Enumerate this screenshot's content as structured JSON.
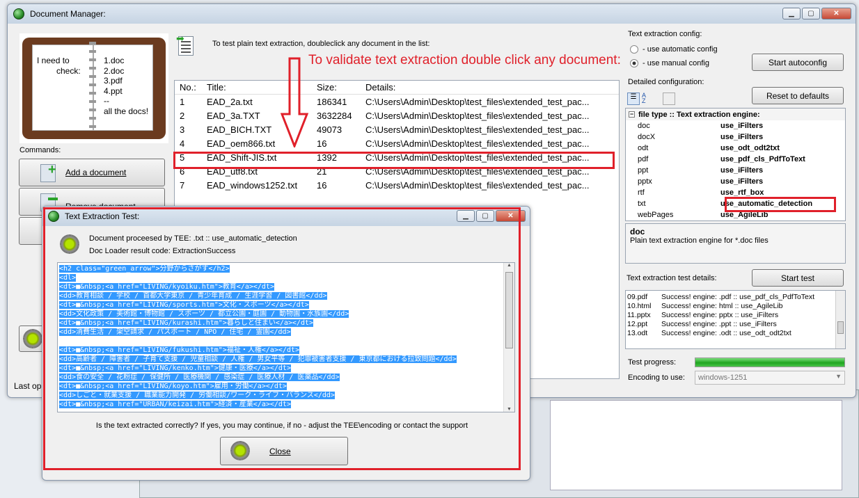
{
  "main_window": {
    "title": "Document Manager:",
    "hint": "To test plain text extraction, doubleclick any document in the list:",
    "commands_label": "Commands:",
    "add_document": "Add a document",
    "remove_document": "Remove document",
    "status_text": "Last op",
    "notebook": {
      "left": [
        "I need to",
        "check:"
      ],
      "right": [
        "1.doc",
        "2.doc",
        "3.pdf",
        "4.ppt",
        "--",
        "all the docs!"
      ]
    },
    "table": {
      "headers": [
        "No.:",
        "Title:",
        "Size:",
        "Details:"
      ],
      "rows": [
        {
          "no": "1",
          "title": "EAD_2a.txt",
          "size": "186341",
          "details": "C:\\Users\\Admin\\Desktop\\test_files\\extended_test_pac..."
        },
        {
          "no": "2",
          "title": "EAD_3a.TXT",
          "size": "3632284",
          "details": "C:\\Users\\Admin\\Desktop\\test_files\\extended_test_pac..."
        },
        {
          "no": "3",
          "title": "EAD_BICH.TXT",
          "size": "49073",
          "details": "C:\\Users\\Admin\\Desktop\\test_files\\extended_test_pac..."
        },
        {
          "no": "4",
          "title": "EAD_oem866.txt",
          "size": "16",
          "details": "C:\\Users\\Admin\\Desktop\\test_files\\extended_test_pac..."
        },
        {
          "no": "5",
          "title": "EAD_Shift-JIS.txt",
          "size": "1392",
          "details": "C:\\Users\\Admin\\Desktop\\test_files\\extended_test_pac..."
        },
        {
          "no": "6",
          "title": "EAD_utf8.txt",
          "size": "21",
          "details": "C:\\Users\\Admin\\Desktop\\test_files\\extended_test_pac..."
        },
        {
          "no": "7",
          "title": "EAD_windows1252.txt",
          "size": "16",
          "details": "C:\\Users\\Admin\\Desktop\\test_files\\extended_test_pac..."
        }
      ]
    }
  },
  "annotation": {
    "text": "To validate text extraction double click any document:",
    "color": "#e0202a"
  },
  "config": {
    "label": "Text extraction config:",
    "auto_option": "- use automatic config",
    "manual_option": "- use manual config",
    "start_autoconfig": "Start autoconfig",
    "detailed_label": "Detailed configuration:",
    "reset_defaults": "Reset to defaults",
    "grid_header": "file type :: Text extraction engine:",
    "items": [
      {
        "key": "doc",
        "value": "use_iFilters"
      },
      {
        "key": "docX",
        "value": "use_iFilters"
      },
      {
        "key": "odt",
        "value": "use_odt_odt2txt"
      },
      {
        "key": "pdf",
        "value": "use_pdf_cls_PdfToText"
      },
      {
        "key": "ppt",
        "value": "use_iFilters"
      },
      {
        "key": "pptx",
        "value": "use_iFilters"
      },
      {
        "key": "rtf",
        "value": "use_rtf_box"
      },
      {
        "key": "txt",
        "value": "use_automatic_detection"
      },
      {
        "key": "webPages",
        "value": "use_AgileLib"
      }
    ],
    "desc_title": "doc",
    "desc_text": "Plain text extraction engine for *.doc files",
    "test_details_label": "Text extraction test details:",
    "start_test": "Start test",
    "log": [
      {
        "file": "09.pdf",
        "msg": "Success! engine: .pdf :: use_pdf_cls_PdfToText"
      },
      {
        "file": "10.html",
        "msg": "Success! engine: html :: use_AgileLib"
      },
      {
        "file": "11.pptx",
        "msg": "Success! engine: pptx :: use_iFilters"
      },
      {
        "file": "12.ppt",
        "msg": "Success! engine: .ppt :: use_iFilters"
      },
      {
        "file": "13.odt",
        "msg": "Success! engine: .odt :: use_odt_odt2txt"
      }
    ],
    "progress_label": "Test progress:",
    "progress": 1.0,
    "encoding_label": "Encoding to use:",
    "encoding_value": "windows-1251"
  },
  "dialog": {
    "title": "Text Extraction Test:",
    "processed_line": "Document proceesed by TEE: .txt :: use_automatic_detection",
    "result_line": "Doc Loader result code: ExtractionSuccess",
    "lines": [
      "<h2 class=\"green_arrow\">分野からさがす</h2>",
      "<dl>",
      "<dt>■&nbsp;<a href=\"LIVING/kyoiku.htm\">教育</a></dt>",
      "<dd>教育相談 / 学校 / 首都大学東京 / 青少年育成 / 生涯学習 / 図書館</dd>",
      "<dt>■&nbsp;<a href=\"LIVING/sports.htm\">文化・スポーツ</a></dt>",
      "<dd>文化政策 / 美術館・博物館 / スポーツ / 都立公園・庭園 / 動物園・水族園</dd>",
      "<dt>■&nbsp;<a href=\"LIVING/kurashi.htm\">暮らしと住まい</a></dt>",
      "<dd>消費生活 / 架空請求 / パスポート / NPO / 住宅 / 霊園</dd>",
      "",
      "<dt>■&nbsp;<a href=\"LIVING/fukushi.htm\">福祉・人権</a></dt>",
      "<dd>高齢者 / 障害者 / 子育て支援 / 児童相談 / 人権 / 男女平等 / 犯罪被害者支援 / 東京都における拉致問題</dd>",
      "<dt>■&nbsp;<a href=\"LIVING/kenko.htm\">健康・医療</a></dt>",
      "<dd>食の安全 / 花粉症 / 保健所 / 医療機関 / 感染症 / 医療人材 / 医薬品</dd>",
      "<dt>■&nbsp;<a href=\"LIVING/koyo.htm\">雇用・労働</a></dt>",
      "<dd>しごと・就業支援 / 職業能力開発 / 労働相談/ワーク・ライフ・バランス</dd>",
      "<dt>■&nbsp;<a href=\"URBAN/keizai.htm\">経済・産業</a></dt>"
    ],
    "question": "Is the text extracted correctly? If yes, you may continue, if no - adjust the TEE\\encoding or contact the support",
    "close": "Close"
  }
}
